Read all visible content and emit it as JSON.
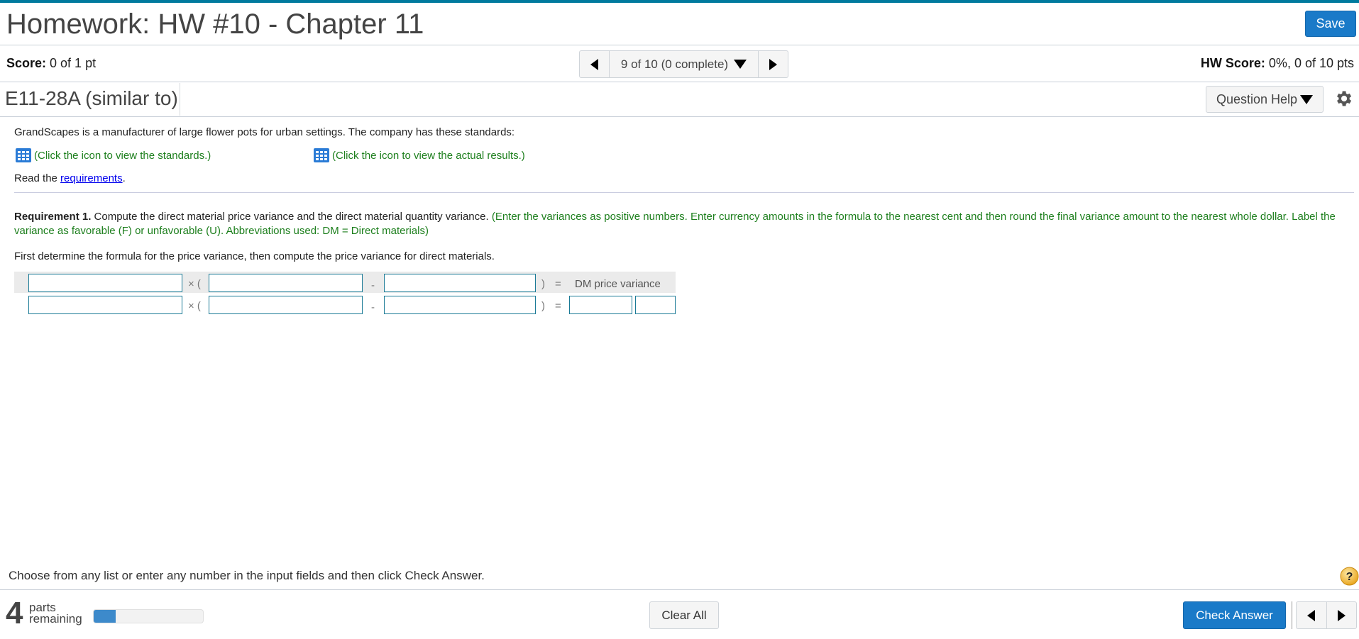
{
  "header": {
    "title": "Homework: HW #10 - Chapter 11",
    "save_label": "Save"
  },
  "scorebar": {
    "score_label": "Score:",
    "score_value": " 0 of 1 pt",
    "question_nav": "9 of 10 (0 complete)",
    "hw_score_label": "HW Score:",
    "hw_score_value": " 0%, 0 of 10 pts"
  },
  "question": {
    "id": "E11-28A (similar to)",
    "help_label": "Question Help"
  },
  "body": {
    "intro": "GrandScapes is a manufacturer of large flower pots for urban settings. The company has these standards:",
    "standards_link": "(Click the icon to view the standards.)",
    "actuals_link": "(Click the icon to view the actual results.)",
    "read_prefix": "Read the ",
    "requirements_link": "requirements",
    "read_suffix": ".",
    "requirement_label": "Requirement 1.",
    "requirement_text": " Compute the direct material price variance and the direct material quantity variance. ",
    "requirement_note": "(Enter the variances as positive numbers. Enter currency amounts in the formula to the nearest cent and then round the final variance amount to the nearest whole dollar. Label the variance as favorable (F) or unfavorable (U). Abbreviations used: DM = Direct materials)",
    "instruction": "First determine the formula for the price variance, then compute the price variance for direct materials."
  },
  "formula": {
    "times_paren": "× (",
    "minus": "-",
    "close_paren": ")",
    "equals": "=",
    "result_label": "DM price variance",
    "row1": {
      "factor": "",
      "term1": "",
      "term2": ""
    },
    "row2": {
      "factor": "",
      "term1": "",
      "term2": "",
      "amount": "",
      "label": ""
    }
  },
  "footer": {
    "instruction": "Choose from any list or enter any number in the input fields and then click Check Answer.",
    "parts_count": "4",
    "parts_label_1": "parts",
    "parts_label_2": "remaining",
    "progress_percent": 20,
    "clear_all_label": "Clear All",
    "check_answer_label": "Check Answer"
  },
  "colors": {
    "topbar": "#007a9e",
    "primary_button": "#1a7ac8",
    "note_green": "#1d7f1d",
    "input_border": "#1a7a96",
    "progress_fill": "#3d8acb"
  }
}
